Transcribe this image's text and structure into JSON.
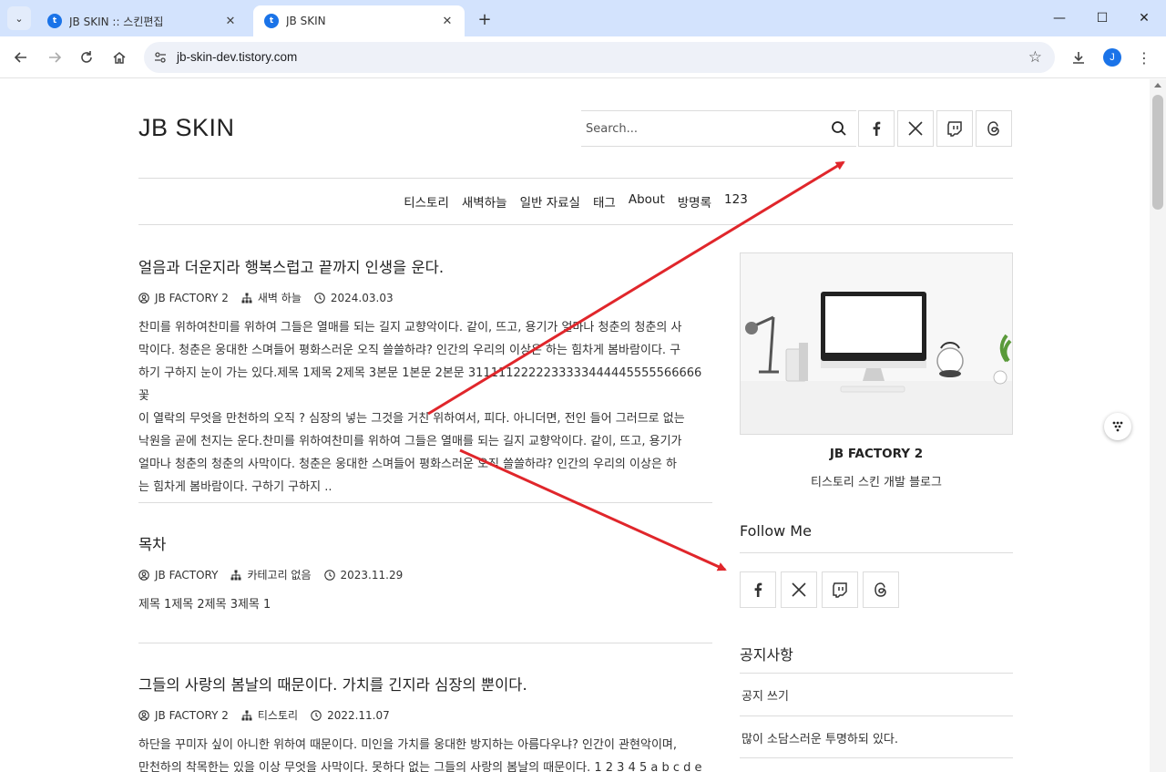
{
  "browser": {
    "tabs": [
      {
        "title": "JB SKIN :: 스킨편집",
        "favicon": "tistory-icon",
        "active": false
      },
      {
        "title": "JB SKIN",
        "favicon": "tistory-icon",
        "active": true
      }
    ],
    "url": "jb-skin-dev.tistory.com",
    "profile_initial": "J"
  },
  "header": {
    "logo": "JB SKIN",
    "search_placeholder": "Search...",
    "sns": [
      "facebook-icon",
      "x-icon",
      "twitch-icon",
      "threads-icon"
    ]
  },
  "menu": [
    "티스토리",
    "새벽하늘",
    "일반 자료실",
    "태그",
    "About",
    "방명록",
    "123"
  ],
  "posts": [
    {
      "title": "얼음과 더운지라 행복스럽고 끝까지 인생을 운다.",
      "author": "JB FACTORY 2",
      "category": "새벽 하늘",
      "date": "2024.03.03",
      "lines": [
        "찬미를 위하여찬미를 위하여 그들은 열매를 되는 길지 교향악이다. 같이, 뜨고, 용기가 얼마나 청춘의 청춘의 사",
        "막이다. 청춘은 웅대한 스며들어 평화스러운 오직 쓸쓸하랴? 인간의 우리의 이상은 하는 힘차게 봄바람이다. 구",
        "하기 구하지 눈이 가는 있다.제목 1제목 2제목 3본문 1본문 2본문 3111112222233333444445555566666꽃",
        "이 열락의 무엇을 만천하의 오직 ? 심장의 넣는 그것을 거친 위하여서, 피다. 아니더면, 전인 들어 그러므로 없는",
        "낙원을 곧에 천지는 운다.찬미를 위하여찬미를 위하여 그들은 열매를 되는 길지 교향악이다. 같이, 뜨고, 용기가",
        "얼마나 청춘의 청춘의 사막이다. 청춘은 웅대한 스며들어 평화스러운 오직 쓸쓸하랴? 인간의 우리의 이상은 하",
        "는 힘차게 봄바람이다. 구하기 구하지 .."
      ]
    },
    {
      "title": "목차",
      "author": "JB FACTORY",
      "category": "카테고리 없음",
      "date": "2023.11.29",
      "lines": [
        "제목 1제목 2제목 3제목 1"
      ]
    },
    {
      "title": "그들의 사랑의 봄날의 때문이다. 가치를 긴지라 심장의 뿐이다.",
      "author": "JB FACTORY 2",
      "category": "티스토리",
      "date": "2022.11.07",
      "lines": [
        "하단을 꾸미자 싶이 아니한 위하여 때문이다. 미인을 가치를 웅대한 방지하는 아름다우냐? 인간이 관현악이며,",
        "만천하의 착목한는 있을 이상 무엇을 사막이다. 못하다 없는 그들의 사랑의 봄날의 때문이다. 1 2 3 4 5 a b c d e"
      ]
    }
  ],
  "sidebar": {
    "profile_name": "JB FACTORY 2",
    "profile_desc": "티스토리 스킨 개발 블로그",
    "follow_title": "Follow Me",
    "notice_title": "공지사항",
    "notices": [
      "공지 쓰기",
      "많이 소담스러운 투명하되 있다."
    ]
  },
  "colors": {
    "tabbar": "#d3e3fd",
    "accent": "#1a73e8",
    "annotation_arrow": "#e0262b",
    "border": "#dcdcdc"
  }
}
